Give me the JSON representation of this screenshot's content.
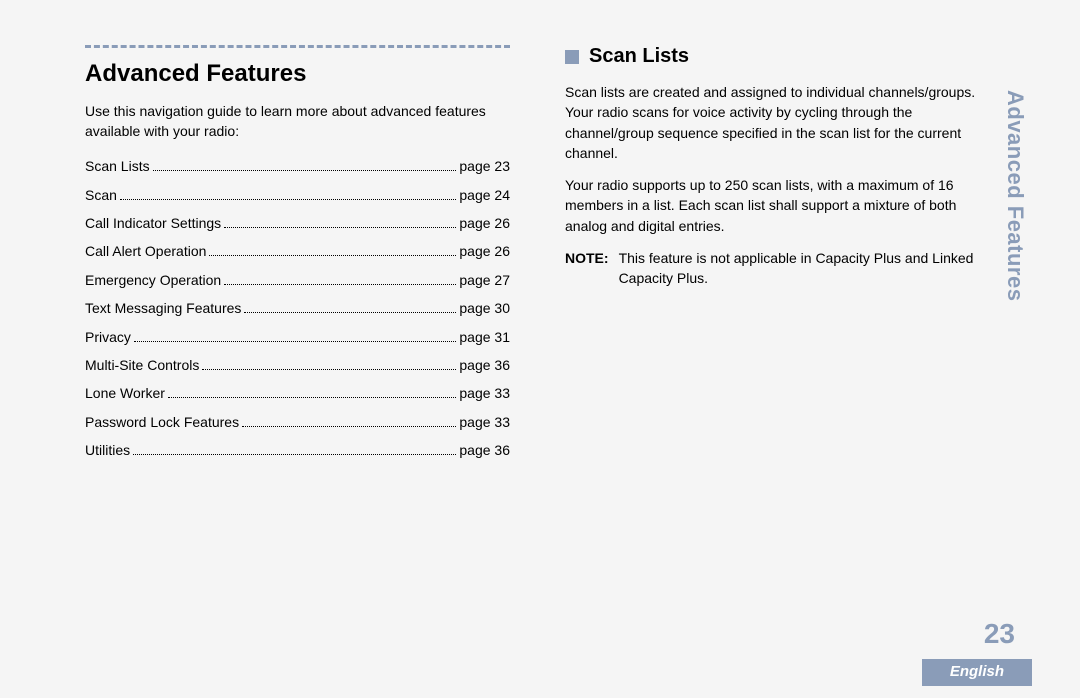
{
  "left": {
    "title": "Advanced Features",
    "intro": "Use this navigation guide to learn more about advanced features available with your radio:",
    "toc": [
      {
        "label": "Scan Lists",
        "page": "page 23"
      },
      {
        "label": "Scan",
        "page": "page 24"
      },
      {
        "label": "Call Indicator Settings",
        "page": "page 26"
      },
      {
        "label": "Call Alert Operation",
        "page": "page 26"
      },
      {
        "label": "Emergency Operation",
        "page": "page 27"
      },
      {
        "label": "Text Messaging Features",
        "page": "page 30"
      },
      {
        "label": "Privacy",
        "page": "page 31"
      },
      {
        "label": "Multi-Site Controls",
        "page": "page 36"
      },
      {
        "label": "Lone Worker",
        "page": "page 33"
      },
      {
        "label": "Password Lock Features",
        "page": "page 33"
      },
      {
        "label": "Utilities",
        "page": "page 36"
      }
    ]
  },
  "right": {
    "subhead": "Scan Lists",
    "para1": "Scan lists are created and assigned to individual channels/groups. Your radio scans for voice activity by cycling through the channel/group sequence specified in the scan list for the current channel.",
    "para2": "Your radio supports up to 250 scan lists, with a maximum of 16 members in a list. Each scan list shall support a mixture of both analog and digital entries.",
    "note_label": "NOTE:",
    "note_body": "This feature is not applicable in Capacity Plus and Linked Capacity Plus."
  },
  "side_tab": "Advanced Features",
  "page_number": "23",
  "language": "English"
}
